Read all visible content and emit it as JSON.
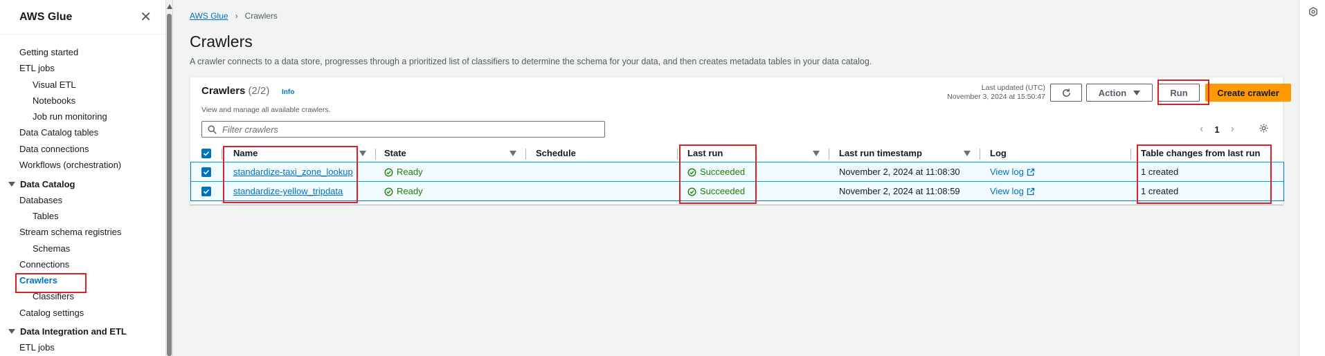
{
  "sidebar": {
    "title": "AWS Glue",
    "items": [
      {
        "label": "Getting started"
      },
      {
        "label": "ETL jobs"
      },
      {
        "label": "Visual ETL"
      },
      {
        "label": "Notebooks"
      },
      {
        "label": "Job run monitoring"
      },
      {
        "label": "Data Catalog tables"
      },
      {
        "label": "Data connections"
      },
      {
        "label": "Workflows (orchestration)"
      }
    ],
    "section_catalog": "Data Catalog",
    "catalog_items": [
      {
        "label": "Databases"
      },
      {
        "label": "Tables"
      },
      {
        "label": "Stream schema registries"
      },
      {
        "label": "Schemas"
      },
      {
        "label": "Connections"
      },
      {
        "label": "Crawlers"
      },
      {
        "label": "Classifiers"
      },
      {
        "label": "Catalog settings"
      }
    ],
    "section_integration": "Data Integration and ETL",
    "integration_items": [
      {
        "label": "ETL jobs"
      }
    ]
  },
  "breadcrumb": {
    "root": "AWS Glue",
    "current": "Crawlers"
  },
  "page": {
    "title": "Crawlers",
    "description": "A crawler connects to a data store, progresses through a prioritized list of classifiers to determine the schema for your data, and then creates metadata tables in your data catalog."
  },
  "panel": {
    "title": "Crawlers",
    "count": "(2/2)",
    "info": "Info",
    "description": "View and manage all available crawlers.",
    "last_updated_label": "Last updated (UTC)",
    "last_updated_value": "November 3, 2024 at 15:50:47",
    "action_label": "Action",
    "run_label": "Run",
    "create_label": "Create crawler",
    "filter_placeholder": "Filter crawlers",
    "page_number": "1"
  },
  "table": {
    "headers": {
      "name": "Name",
      "state": "State",
      "schedule": "Schedule",
      "last_run": "Last run",
      "last_run_timestamp": "Last run timestamp",
      "log": "Log",
      "table_changes": "Table changes from last run"
    },
    "rows": [
      {
        "name": "standardize-taxi_zone_lookup",
        "state": "Ready",
        "schedule": "",
        "last_run": "Succeeded",
        "last_run_timestamp": "November 2, 2024 at 11:08:30",
        "log": "View log",
        "table_changes": "1 created"
      },
      {
        "name": "standardize-yellow_tripdata",
        "state": "Ready",
        "schedule": "",
        "last_run": "Succeeded",
        "last_run_timestamp": "November 2, 2024 at 11:08:59",
        "log": "View log",
        "table_changes": "1 created"
      }
    ]
  },
  "colors": {
    "accent": "#0073bb",
    "primary_button": "#ff9900",
    "success": "#1d8102",
    "highlight": "#e41e20"
  },
  "icons": [
    "close-icon",
    "refresh-icon",
    "caret-down-icon",
    "search-icon",
    "chevron-left-icon",
    "chevron-right-icon",
    "settings-icon",
    "check-circle-icon",
    "external-link-icon",
    "checkbox-checked-icon"
  ]
}
